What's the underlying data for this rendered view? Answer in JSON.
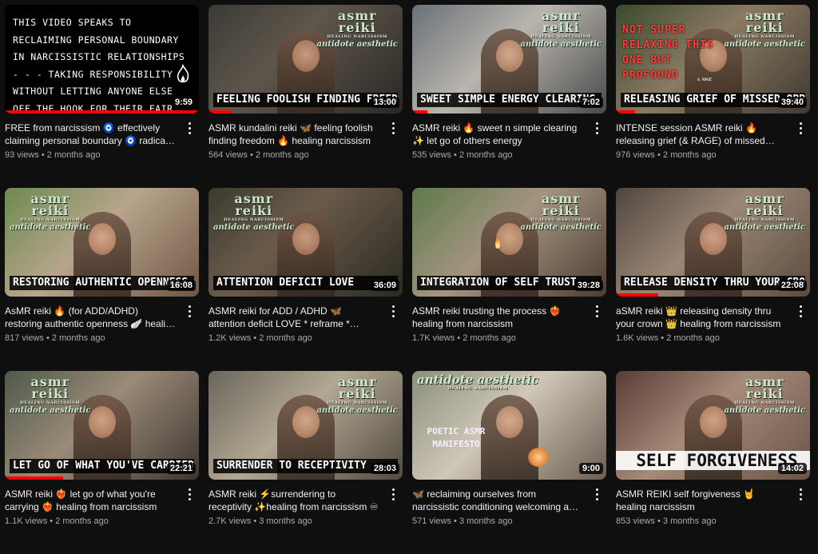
{
  "colors": {
    "accent": "#ff0000",
    "background": "#0f0f0f"
  },
  "videos": [
    {
      "title": "FREE from narcissism 🧿 effectively claiming personal boundary 🧿 radical inner...",
      "views": "93 views",
      "age": "2 months ago",
      "duration": "9:59",
      "thumb_text": "THIS VIDEO SPEAKS TO RECLAIMING PERSONAL BOUNDARY IN NARCISSISTIC RELATIONSHIPS - - - TAKING RESPONSIBILITY WITHOUT LETTING ANYONE ELSE OFF THE HOOK FOR THEIR FAIR SHARE",
      "progress": 1.0
    },
    {
      "title": "ASMR kundalini reiki 🦋 feeling foolish finding freedom 🔥 healing narcissism",
      "views": "564 views",
      "age": "2 months ago",
      "duration": "13:00",
      "caption": "FEELING FOOLISH FINDING FREEDOM",
      "progress": 0.12
    },
    {
      "title": "ASMR reiki 🔥 sweet n simple clearing ✨ let go of others energy",
      "views": "535 views",
      "age": "2 months ago",
      "duration": "7:02",
      "caption": "SWEET SIMPLE ENERGY CLEARING",
      "progress": 0.08
    },
    {
      "title": "INTENSE session ASMR reiki 🔥 releasing grief (& RAGE) of missed opportunity🔥...",
      "views": "976 views",
      "age": "2 months ago",
      "duration": "39:40",
      "caption": "RELEASING GRIEF OF MISSED OPPORTUNITIES",
      "neon": "NOT SUPER RELAXING THIS ONE BUT PROFOUND",
      "neon_small": "& RAGE",
      "progress": 0.1
    },
    {
      "title": "AsMR reiki 🔥 (for ADD/ADHD) restoring authentic openness 🪽 healing from...",
      "views": "817 views",
      "age": "2 months ago",
      "duration": "16:08",
      "caption": "RESTORING AUTHENTIC OPENNESS",
      "progress": 0.0
    },
    {
      "title": "ASMR reiki for ADD / ADHD 🦋 attention deficit LOVE * reframe * reconnect * 🦋...",
      "views": "1.2K views",
      "age": "2 months ago",
      "duration": "36:09",
      "caption": "ATTENTION DEFICIT LOVE",
      "progress": 0.0
    },
    {
      "title": "ASMR reiki trusting the process ❤️‍🔥 healing from narcissism",
      "views": "1.7K views",
      "age": "2 months ago",
      "duration": "39:28",
      "caption": "INTEGRATION OF SELF TRUST",
      "progress": 0.0
    },
    {
      "title": "aSMR reiki 👑 releasing density thru your crown 👑 healing from narcissism",
      "views": "1.6K views",
      "age": "2 months ago",
      "duration": "22:08",
      "caption": "RELEASE DENSITY THRU YOUR CROWN",
      "progress": 0.22
    },
    {
      "title": "ASMR reiki ❤️‍🔥 let go of what you're carrying ❤️‍🔥 healing from narcissism",
      "views": "1.1K views",
      "age": "2 months ago",
      "duration": "22:21",
      "caption": "LET GO OF WHAT YOU'VE CARRIED",
      "progress": 0.3
    },
    {
      "title": "ASMR reiki ⚡surrendering to receptivity ✨healing from narcissism ♾",
      "views": "2.7K views",
      "age": "3 months ago",
      "duration": "28:03",
      "caption": "SURRENDER TO RECEPTIVITY",
      "progress": 0.0
    },
    {
      "title": "🦋 reclaiming ourselves from narcissistic conditioning welcoming a liberated...",
      "views": "571 views",
      "age": "3 months ago",
      "duration": "9:00",
      "poetic": "POETIC ASMR MANIFESTO",
      "progress": 0.0
    },
    {
      "title": "ASMR REIKI self forgiveness 🤘 healing narcissism",
      "views": "853 views",
      "age": "3 months ago",
      "duration": "14:02",
      "caption": "SELF FORGIVENESS",
      "progress": 0.0
    }
  ],
  "branding": {
    "word": "asmr",
    "word2": "reiki",
    "tagline": "HEALING NARCISSISM",
    "aesthetic": "antidote aesthetic"
  }
}
